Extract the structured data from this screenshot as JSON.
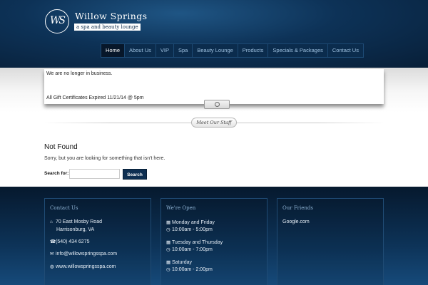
{
  "brand": {
    "monogram": "WS",
    "name": "Willow Springs",
    "tagline": "a spa and beauty lounge"
  },
  "nav": {
    "items": [
      "Home",
      "About Us",
      "VIP",
      "Spa",
      "Beauty Lounge",
      "Products",
      "Specials & Packages",
      "Contact Us"
    ],
    "active": "Home"
  },
  "notice": {
    "line1": "We are no longer in business.",
    "line2": "All Gift Certificates Expired 11/21/14 @ 5pm"
  },
  "staff_button": "Meet Our Staff",
  "not_found": {
    "title": "Not Found",
    "message": "Sorry, but you are looking for something that isn't here."
  },
  "search": {
    "label": "Search for:",
    "value": "",
    "button": "Search"
  },
  "footer": {
    "contact": {
      "heading": "Contact Us",
      "address1": "70 East Mosby Road",
      "address2": "Harrisonburg, VA",
      "phone": "(540) 434 6275",
      "email": "info@willowspringsspa.com",
      "website": "www.willowspringsspa.com"
    },
    "hours": {
      "heading": "We're Open",
      "days1": "Monday and Friday",
      "time1": "10:00am - 5:00pm",
      "days2": "Tuesday and Thursday",
      "time2": "10:00am - 7:00pm",
      "days3": "Saturday",
      "time3": "10:00am - 2:00pm"
    },
    "friends": {
      "heading": "Our Friends",
      "link1": "Google.com"
    }
  },
  "icons": {
    "home": "home-icon",
    "phone": "phone-icon",
    "email": "envelope-icon",
    "web": "globe-icon",
    "calendar": "calendar-icon",
    "clock": "clock-icon"
  },
  "colors": {
    "header_dark": "#081f38",
    "nav_bg": "#0b2c4d",
    "button": "#0e2f52",
    "footer_dark": "#06192e"
  }
}
